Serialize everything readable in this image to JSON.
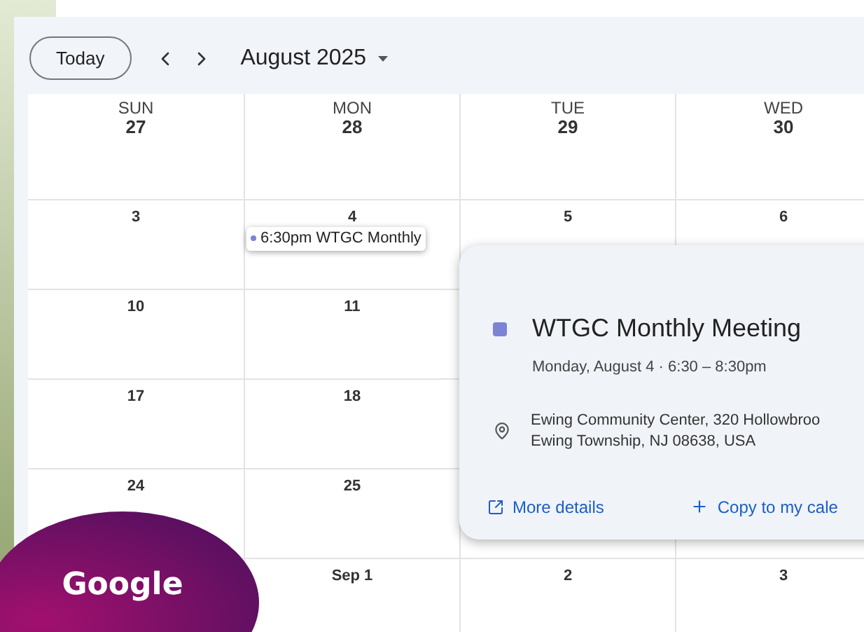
{
  "toolbar": {
    "today": "Today",
    "month": "August 2025"
  },
  "header": [
    {
      "weekday": "SUN",
      "date": "27"
    },
    {
      "weekday": "MON",
      "date": "28"
    },
    {
      "weekday": "TUE",
      "date": "29"
    },
    {
      "weekday": "WED",
      "date": "30"
    }
  ],
  "weeks": [
    {
      "sun": {
        "date": "3"
      },
      "mon": {
        "date": "4",
        "events": [
          {
            "label": "6:30pm WTGC Monthly",
            "color": "#7c83d4"
          }
        ]
      },
      "tue": {
        "date": "5"
      },
      "wed": {
        "date": "6"
      }
    },
    {
      "sun": {
        "date": "10"
      },
      "mon": {
        "date": "11"
      }
    },
    {
      "sun": {
        "date": "17"
      },
      "mon": {
        "date": "18"
      }
    },
    {
      "sun": {
        "date": "24"
      },
      "mon": {
        "date": "25"
      }
    },
    {
      "mon": {
        "date": "Sep 1"
      },
      "tue": {
        "date": "2"
      },
      "wed": {
        "date": "3"
      }
    }
  ],
  "popup": {
    "title": "WTGC Monthly Meeting",
    "color": "#7c83d4",
    "when": "Monday, August 4 · 6:30 – 8:30pm",
    "location": [
      "Ewing Community Center, 320 Hollowbroo",
      "Ewing Township, NJ 08638, USA"
    ],
    "actions": [
      {
        "kind": "details",
        "label": "More details"
      },
      {
        "kind": "copy",
        "label": "Copy to my cale"
      }
    ]
  },
  "badge": {
    "text": "Google"
  }
}
